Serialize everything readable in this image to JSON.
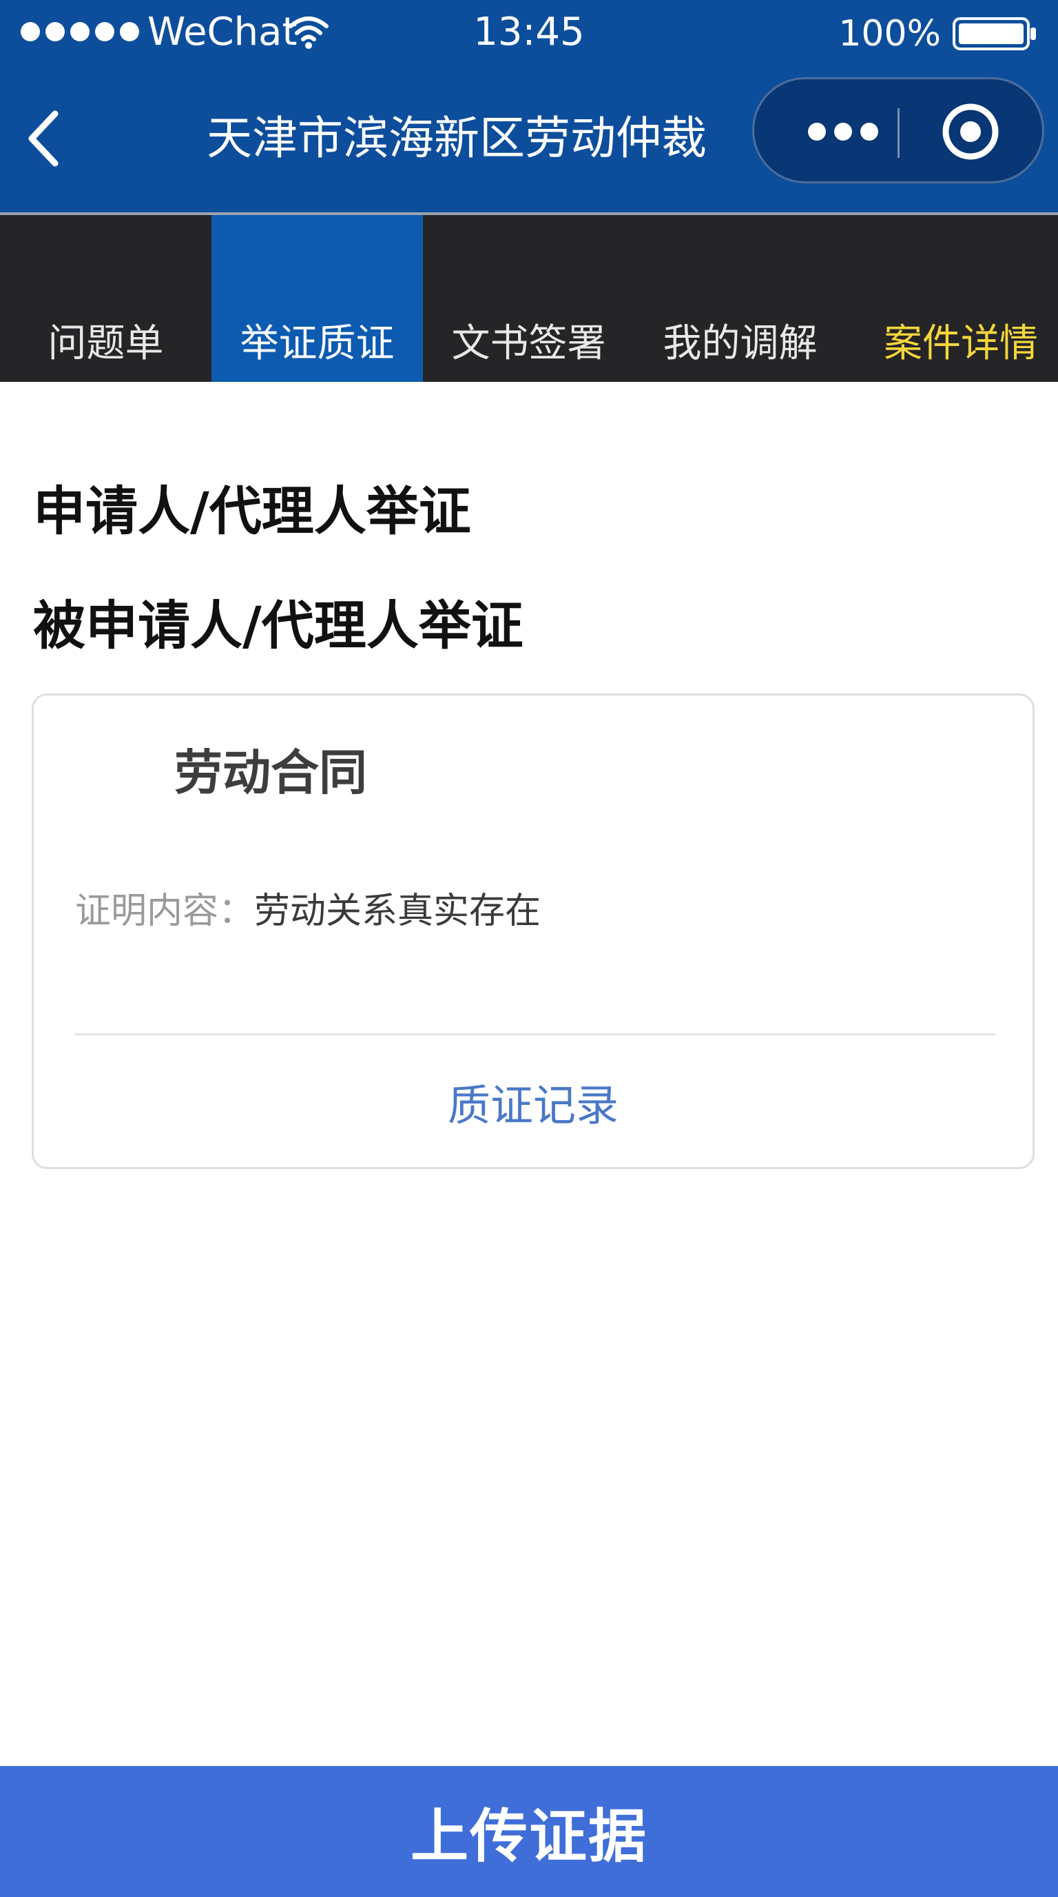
{
  "status_bar": {
    "carrier": "WeChat",
    "time": "13:45",
    "battery": "100%"
  },
  "nav": {
    "title": "天津市滨海新区劳动仲裁"
  },
  "tabs": [
    {
      "label": "问题单"
    },
    {
      "label": "举证质证"
    },
    {
      "label": "文书签署"
    },
    {
      "label": "我的调解"
    },
    {
      "label": "案件详情"
    }
  ],
  "active_tab": "举证质证",
  "colors": {
    "header_bg": "#0d4e9c",
    "tab_bar_bg": "#252528",
    "tab_active_bg": "#0d5bb0",
    "tab_highlight_text": "#f4d63b",
    "link_blue": "#4a78c8",
    "primary_button": "#3f6ed9"
  },
  "main": {
    "applicant_heading": "申请人/代理人举证",
    "respondent_heading": "被申请人/代理人举证",
    "evidence_card": {
      "title": "劳动合同",
      "content_label": "证明内容：",
      "content_value": "劳动关系真实存在",
      "action": "质证记录"
    }
  },
  "footer": {
    "upload_button": "上传证据"
  }
}
